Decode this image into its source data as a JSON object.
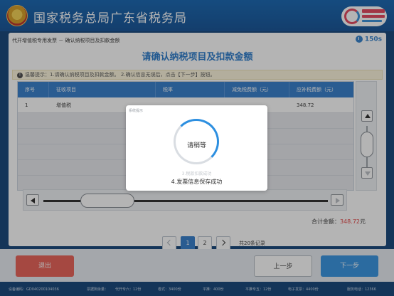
{
  "header": {
    "title": "国家税务总局广东省税务局",
    "emblem_icon": "tax-emblem-icon",
    "brand_icon": "service-brand-logo"
  },
  "panel": {
    "breadcrumb": "代开增值税专用发票 － 确认纳税项目及扣款金额",
    "timer": "150s",
    "title": "请确认纳税项目及扣款金额",
    "tip": "温馨提示：1.请确认纳税项目及扣款金额。 2.确认信息无误后，点击【下一步】按钮。"
  },
  "table": {
    "columns": [
      "序号",
      "征收项目",
      "税率",
      "减免税费额（元）",
      "应补税费额（元）"
    ],
    "rows": [
      [
        "1",
        "增值税",
        "",
        "",
        "348.72"
      ]
    ]
  },
  "total": {
    "label": "合计金额：",
    "value": "348.72",
    "unit": "元"
  },
  "pager": {
    "pages": [
      "1",
      "2"
    ],
    "active": "1",
    "count_text": "共20条记录"
  },
  "buttons": {
    "exit": "退出",
    "prev": "上一步",
    "next": "下一步"
  },
  "status": {
    "device": "设备编码：GD040200104036",
    "supply": "票据剩余量：",
    "box1": "代开专六：12份",
    "box2": "卷式：3400份",
    "box3": "平推：400份",
    "box4": "平推专五：12份",
    "box5": "电子发票：4400份",
    "phone": "服务电话：12366"
  },
  "modal": {
    "label": "系统提示",
    "loading": "请稍等",
    "step_done": "3.税款扣款成功",
    "step_current": "4.发票信息保存成功"
  }
}
